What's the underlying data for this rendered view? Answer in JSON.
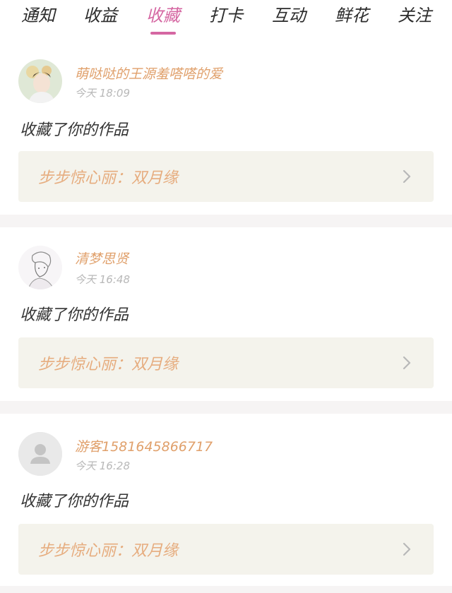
{
  "tabs": [
    {
      "label": "通知",
      "active": false
    },
    {
      "label": "收益",
      "active": false
    },
    {
      "label": "收藏",
      "active": true
    },
    {
      "label": "打卡",
      "active": false
    },
    {
      "label": "互动",
      "active": false
    },
    {
      "label": "鲜花",
      "active": false
    },
    {
      "label": "关注",
      "active": false
    }
  ],
  "colors": {
    "accent": "#d567a2",
    "username": "#e0a06b",
    "work_title": "#e6ac7e",
    "work_box_bg": "#f4f3ec",
    "timestamp": "#b8b8b8",
    "page_bg": "#f6f4f4"
  },
  "notifications": [
    {
      "avatar": "user-avatar-photo",
      "username": "萌哒哒的王源羞嗒嗒的爱",
      "time": "今天 18:09",
      "action": "收藏了你的作品",
      "work_title": "步步惊心丽：双月缘",
      "chevron_icon": "chevron-right-icon"
    },
    {
      "avatar": "user-avatar-sketch",
      "username": "清梦思贤",
      "time": "今天 16:48",
      "action": "收藏了你的作品",
      "work_title": "步步惊心丽：双月缘",
      "chevron_icon": "chevron-right-icon"
    },
    {
      "avatar": "default-avatar-icon",
      "username": "游客1581645866717",
      "time": "今天 16:28",
      "action": "收藏了你的作品",
      "work_title": "步步惊心丽：双月缘",
      "chevron_icon": "chevron-right-icon"
    }
  ]
}
